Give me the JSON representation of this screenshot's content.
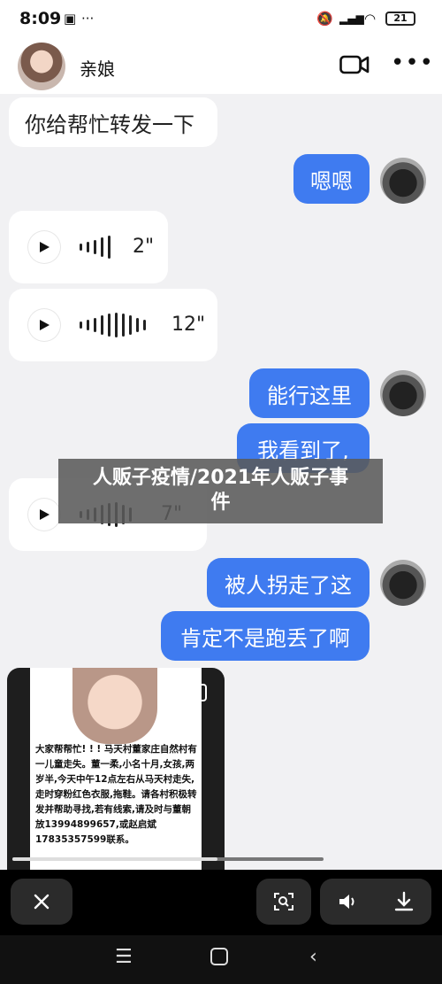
{
  "status": {
    "time": "8:09",
    "battery": "21"
  },
  "chat": {
    "contact_name": "亲娘",
    "messages": {
      "m1": "你给帮忙转发一下",
      "m2": "嗯嗯",
      "v1": "2\"",
      "v2": "12\"",
      "m3": "能行这里",
      "m4": "我看到了,",
      "v3": "7\"",
      "m5": "被人拐走了这",
      "m6": "肯定不是跑丢了啊"
    }
  },
  "overlay": {
    "line1": "人贩子疫情/2021年人贩子事",
    "line2": "件"
  },
  "image_notice": "大家帮帮忙! ! ! 马天村董家庄自然村有一儿童走失。董一柔,小名十月,女孩,两岁半,今天中午12点左右从马天村走失,走时穿粉红色衣服,拖鞋。请各村积极转发并帮助寻找,若有线索,请及时与董朝放13994899657,或赵启斌17835357599联系。",
  "viewer": {
    "progress": 0.66
  },
  "icons": [
    "close-icon",
    "scan-icon",
    "speaker-icon",
    "download-icon",
    "video-call-icon",
    "more-icon",
    "play-icon",
    "gallery-icon"
  ]
}
